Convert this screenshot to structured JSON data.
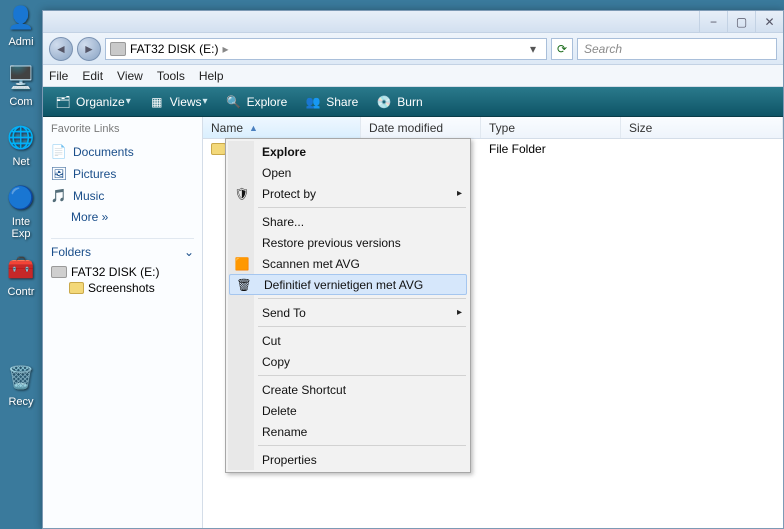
{
  "desktop": {
    "icons": [
      {
        "label": "Admi"
      },
      {
        "label": "Com"
      },
      {
        "label": "Net"
      },
      {
        "label": "Inte Exp"
      },
      {
        "label": ""
      },
      {
        "label": "Contr"
      },
      {
        "label": ""
      },
      {
        "label": "Recy"
      }
    ]
  },
  "titlebar": {
    "min": "−",
    "max": "▢",
    "close": "✕"
  },
  "address": {
    "drive_label": "FAT32 DISK (E:)",
    "sep": "▸",
    "drop": "▾",
    "refresh": "⟳"
  },
  "search": {
    "placeholder": "Search"
  },
  "menubar": {
    "items": [
      "File",
      "Edit",
      "View",
      "Tools",
      "Help"
    ]
  },
  "toolbar": {
    "organize": "Organize",
    "views": "Views",
    "explore": "Explore",
    "share": "Share",
    "burn": "Burn",
    "caret": "▾"
  },
  "sidebar": {
    "fav_title": "Favorite Links",
    "documents": "Documents",
    "pictures": "Pictures",
    "music": "Music",
    "more": "More  »",
    "folders_hdr": "Folders",
    "chevron": "⌄",
    "drive": "FAT32 DISK (E:)",
    "screenshots": "Screenshots"
  },
  "columns": {
    "name": "Name",
    "date": "Date modified",
    "type": "Type",
    "size": "Size",
    "sort": "▲"
  },
  "rows": [
    {
      "name": "",
      "type": "File Folder"
    }
  ],
  "context": {
    "explore": "Explore",
    "open": "Open",
    "protect_by": "Protect by",
    "share": "Share...",
    "restore": "Restore previous versions",
    "scan_avg": "Scannen met AVG",
    "destroy_avg": "Definitief vernietigen met AVG",
    "send_to": "Send To",
    "cut": "Cut",
    "copy": "Copy",
    "create_shortcut": "Create Shortcut",
    "delete": "Delete",
    "rename": "Rename",
    "properties": "Properties",
    "arrow": "▸"
  }
}
